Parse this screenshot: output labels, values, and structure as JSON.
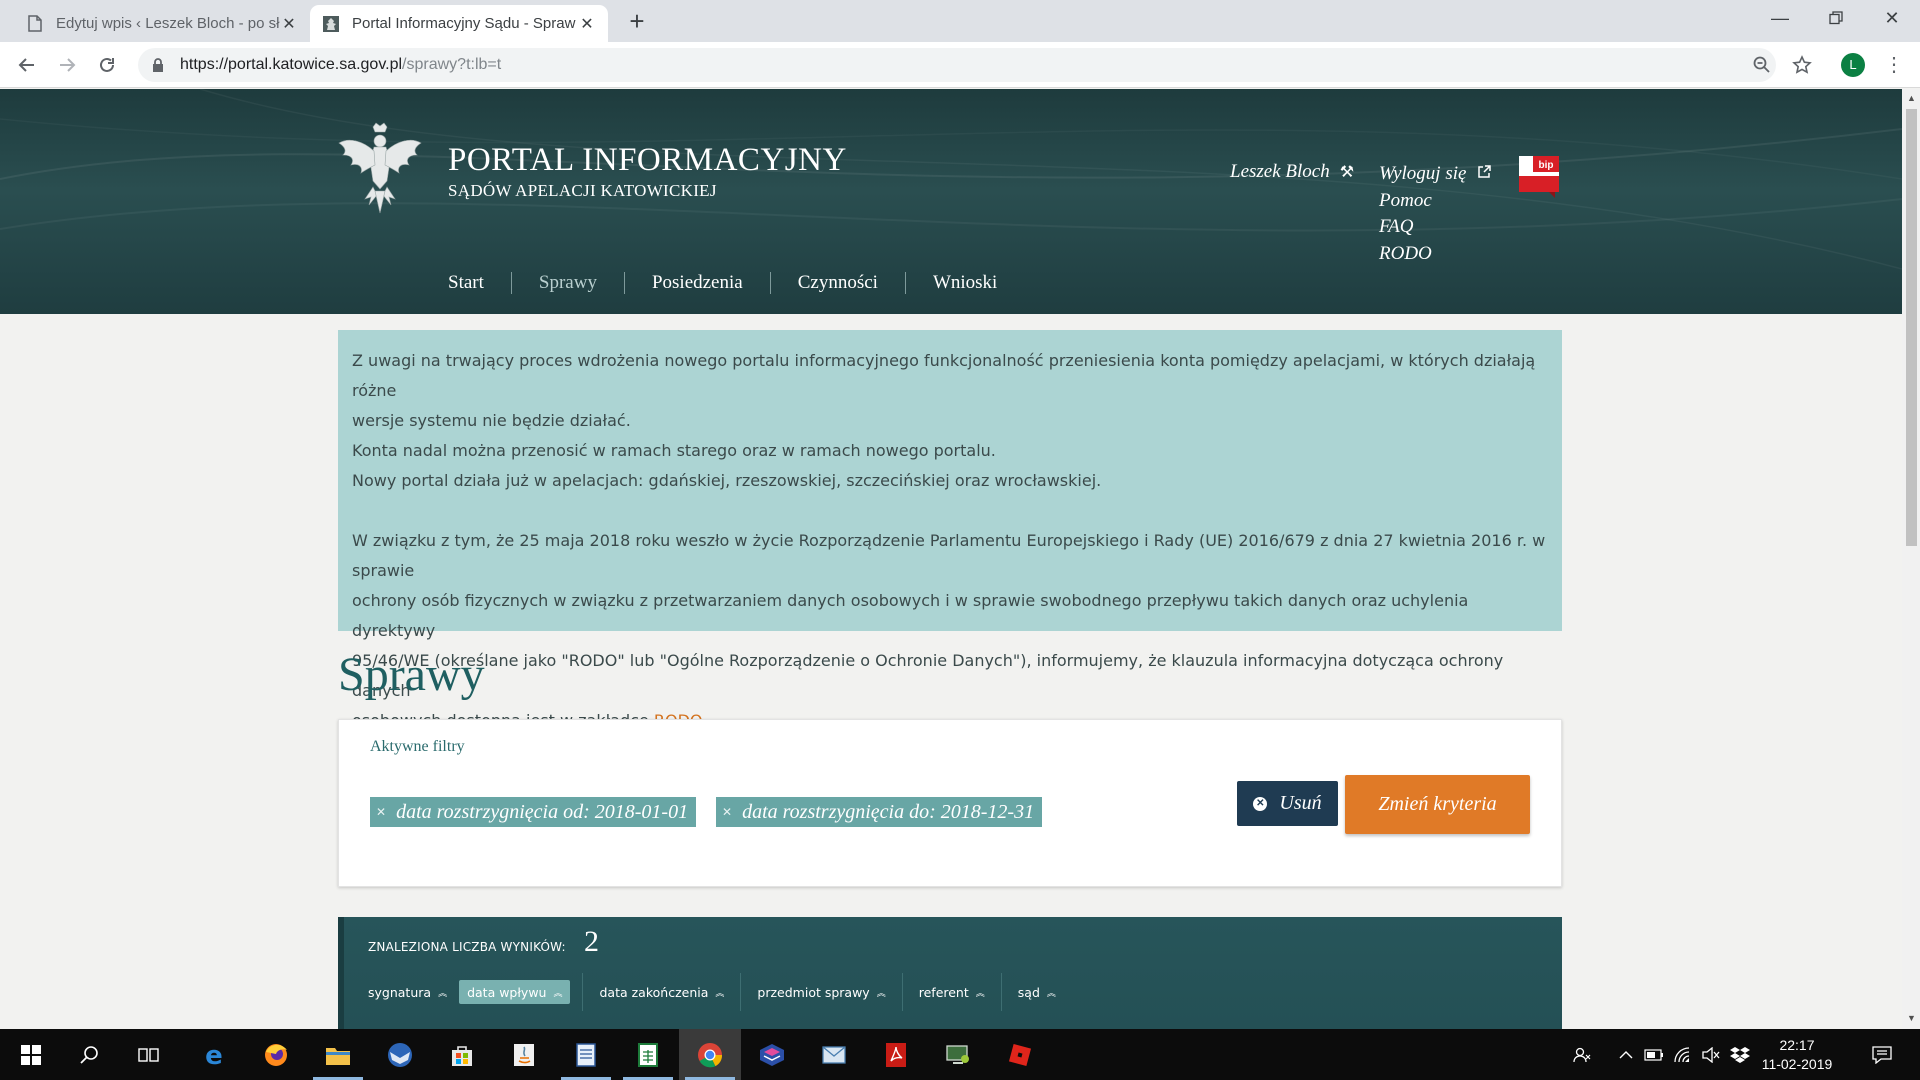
{
  "browser": {
    "tabs": [
      {
        "title": "Edytuj wpis ‹ Leszek Bloch - po sł",
        "active": false,
        "icon": "document-icon"
      },
      {
        "title": "Portal Informacyjny Sądu - Spraw",
        "active": true,
        "icon": "court-emblem-icon"
      }
    ],
    "url_host": "https://portal.katowice.sa.gov.pl",
    "url_path": "/sprawy?t:lb=t",
    "profile_initial": "L"
  },
  "header": {
    "title": "PORTAL INFORMACYJNY",
    "subtitle": "SĄDÓW APELACJI KATOWICKIEJ",
    "user_name": "Leszek Bloch",
    "links": {
      "logout": "Wyloguj się",
      "help": "Pomoc",
      "faq": "FAQ",
      "rodo": "RODO"
    },
    "bip_label": "bip",
    "nav": [
      {
        "label": "Start",
        "current": false
      },
      {
        "label": "Sprawy",
        "current": true
      },
      {
        "label": "Posiedzenia",
        "current": false
      },
      {
        "label": "Czynności",
        "current": false
      },
      {
        "label": "Wnioski",
        "current": false
      }
    ]
  },
  "notice": {
    "line1": "Z uwagi na trwający proces wdrożenia nowego portalu informacyjnego funkcjonalność przeniesienia konta pomiędzy apelacjami, w których działają różne",
    "line2": "wersje systemu nie będzie działać.",
    "line3": "Konta nadal można przenosić w ramach starego oraz w ramach nowego portalu.",
    "line4": "Nowy portal działa już w apelacjach: gdańskiej, rzeszowskiej, szczecińskiej oraz wrocławskiej.",
    "line5": "W związku z tym, że 25 maja 2018 roku weszło w życie Rozporządzenie Parlamentu Europejskiego i Rady (UE) 2016/679 z dnia 27 kwietnia 2016 r. w sprawie",
    "line6": "ochrony osób fizycznych w związku z przetwarzaniem danych osobowych i w sprawie swobodnego przepływu takich danych oraz uchylenia dyrektywy",
    "line7": "95/46/WE (określane jako \"RODO\" lub \"Ogólne Rozporządzenie o Ochronie Danych\"), informujemy, że klauzula informacyjna dotycząca ochrony danych",
    "line8_prefix": "osobowych dostępna jest w zakładce ",
    "line8_link": "RODO",
    "line8_suffix": "."
  },
  "page_title": "Sprawy",
  "filters": {
    "header": "Aktywne filtry",
    "chips": [
      "data rozstrzygnięcia od: 2018-01-01",
      "data rozstrzygnięcia do: 2018-12-31"
    ],
    "remove_label": "Usuń",
    "change_label": "Zmień kryteria"
  },
  "results": {
    "count_label": "ZNALEZIONA LICZBA WYNIKÓW:",
    "count": "2",
    "sort_columns": [
      {
        "label": "sygnatura",
        "active": false
      },
      {
        "label": "data wpływu",
        "active": true
      },
      {
        "label": "data zakończenia",
        "active": false
      },
      {
        "label": "przedmiot sprawy",
        "active": false
      },
      {
        "label": "referent",
        "active": false
      },
      {
        "label": "sąd",
        "active": false
      }
    ]
  },
  "taskbar": {
    "time": "22:17",
    "date": "11-02-2019"
  },
  "colors": {
    "header_bg": "#244547",
    "notice_bg": "#acd4d3",
    "accent_orange": "#e07a27",
    "remove_btn": "#1f3b52",
    "chip_bg": "#68a6a5",
    "title_teal": "#1f5f61"
  }
}
